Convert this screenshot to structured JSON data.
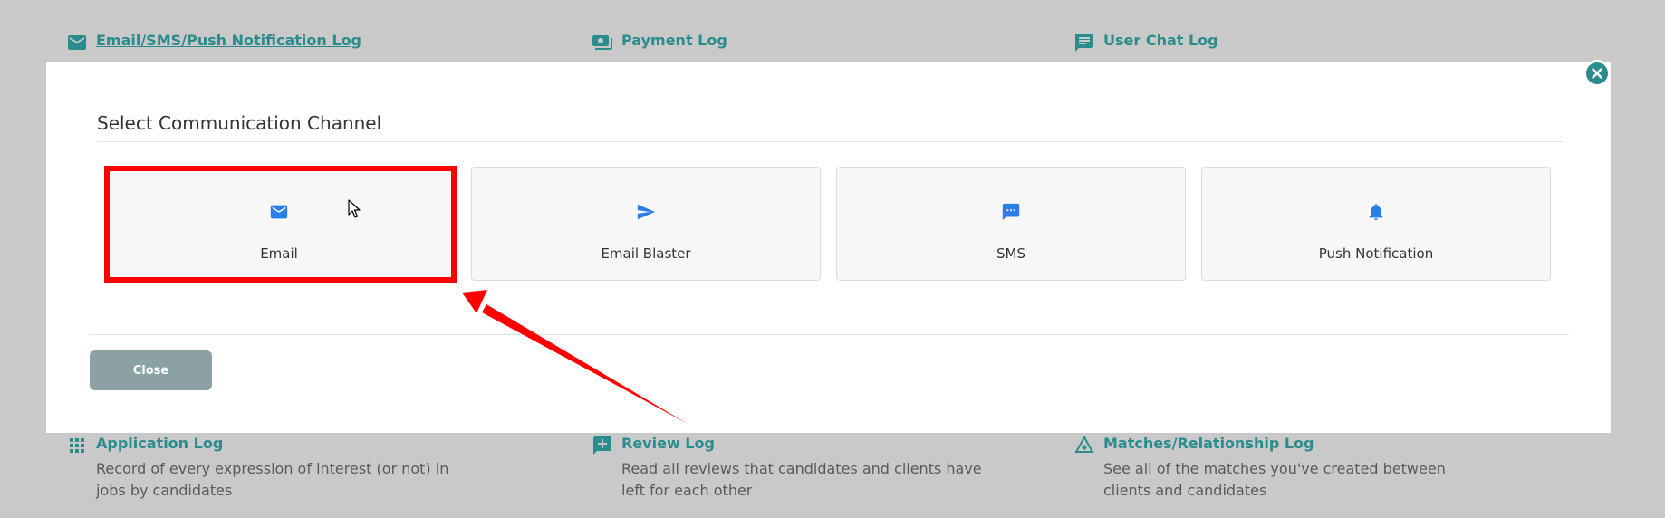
{
  "background": {
    "top_items": [
      {
        "title": "Email/SMS/Push Notification Log",
        "icon": "envelope-icon"
      },
      {
        "title": "Payment Log",
        "icon": "payment-icon"
      },
      {
        "title": "User Chat Log",
        "icon": "chat-icon"
      }
    ],
    "bottom_items": [
      {
        "title": "Application Log",
        "desc": "Record of every expression of interest (or not) in jobs by candidates",
        "icon": "grid-icon"
      },
      {
        "title": "Review Log",
        "desc": "Read all reviews that candidates and clients have left for each other",
        "icon": "review-icon"
      },
      {
        "title": "Matches/Relationship Log",
        "desc": "See all of the matches you've created between clients and candidates",
        "icon": "handshake-icon"
      }
    ]
  },
  "modal": {
    "title": "Select Communication Channel",
    "channels": [
      {
        "label": "Email",
        "icon": "envelope-icon"
      },
      {
        "label": "Email Blaster",
        "icon": "send-icon"
      },
      {
        "label": "SMS",
        "icon": "sms-icon"
      },
      {
        "label": "Push Notification",
        "icon": "bell-icon"
      }
    ],
    "close_label": "Close"
  },
  "colors": {
    "accent": "#2a8c8c",
    "channel_icon": "#2b7de9",
    "highlight": "#ff0000",
    "close_button": "#8ba1a4"
  }
}
